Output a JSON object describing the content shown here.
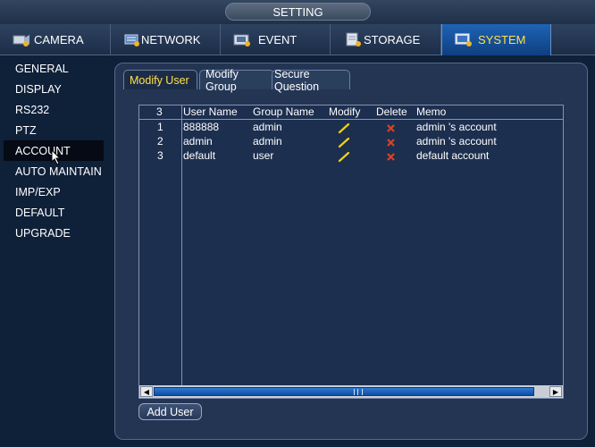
{
  "window": {
    "title": "SETTING"
  },
  "top_tabs": [
    {
      "label": "CAMERA",
      "icon": "camera-icon"
    },
    {
      "label": "NETWORK",
      "icon": "network-icon"
    },
    {
      "label": "EVENT",
      "icon": "event-icon"
    },
    {
      "label": "STORAGE",
      "icon": "storage-icon"
    },
    {
      "label": "SYSTEM",
      "icon": "system-icon",
      "active": true
    }
  ],
  "sidebar": {
    "items": [
      {
        "label": "GENERAL"
      },
      {
        "label": "DISPLAY"
      },
      {
        "label": "RS232"
      },
      {
        "label": "PTZ"
      },
      {
        "label": "ACCOUNT",
        "active": true
      },
      {
        "label": "AUTO MAINTAIN"
      },
      {
        "label": "IMP/EXP"
      },
      {
        "label": "DEFAULT"
      },
      {
        "label": "UPGRADE"
      }
    ]
  },
  "sub_tabs": [
    {
      "label": "Modify User",
      "active": true
    },
    {
      "label": "Modify Group"
    },
    {
      "label": "Secure Question"
    }
  ],
  "table": {
    "count": "3",
    "headers": {
      "user_name": "User Name",
      "group_name": "Group Name",
      "modify": "Modify",
      "delete": "Delete",
      "memo": "Memo"
    },
    "rows": [
      {
        "index": "1",
        "user_name": "888888",
        "group_name": "admin",
        "memo": "admin 's account"
      },
      {
        "index": "2",
        "user_name": "admin",
        "group_name": "admin",
        "memo": "admin 's account"
      },
      {
        "index": "3",
        "user_name": "default",
        "group_name": "user",
        "memo": "default account"
      }
    ]
  },
  "buttons": {
    "add_user": "Add User"
  },
  "colors": {
    "background": "#0f2039",
    "panel": "#233553",
    "active_tab": "#1f63b5",
    "highlight_text": "#ffe04a",
    "delete_icon": "#e04020",
    "modify_icon": "#f2d21a"
  }
}
